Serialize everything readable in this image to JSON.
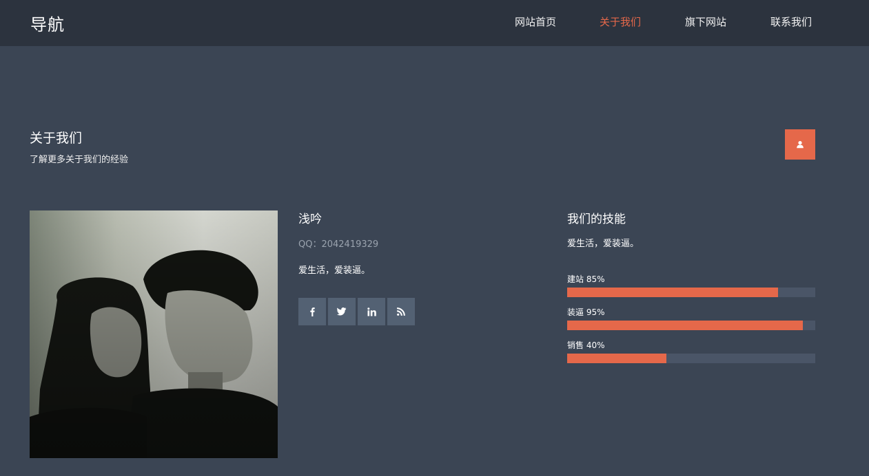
{
  "header": {
    "brand": "导航",
    "nav": [
      {
        "label": "网站首页",
        "active": false
      },
      {
        "label": "关于我们",
        "active": true
      },
      {
        "label": "旗下网站",
        "active": false
      },
      {
        "label": "联系我们",
        "active": false
      }
    ]
  },
  "about": {
    "title": "关于我们",
    "subtitle": "了解更多关于我们的经验",
    "action_icon": "user-icon"
  },
  "profile": {
    "photo_alt": "person-photo",
    "name": "浅吟",
    "qq": "QQ：2042419329",
    "bio": "爱生活，爱装逼。",
    "social_icons": [
      "facebook-icon",
      "twitter-icon",
      "linkedin-icon",
      "rss-icon"
    ]
  },
  "skills": {
    "title": "我们的技能",
    "description": "爱生活，爱装逼。",
    "items": [
      {
        "label": "建站 85%",
        "percent": 85
      },
      {
        "label": "装逼 95%",
        "percent": 95
      },
      {
        "label": "销售 40%",
        "percent": 40
      }
    ]
  },
  "colors": {
    "accent": "#e5684a",
    "header_bg": "#2c333e",
    "page_bg": "#3b4554",
    "social_bg": "#536173",
    "track_bg": "#4a5567"
  }
}
